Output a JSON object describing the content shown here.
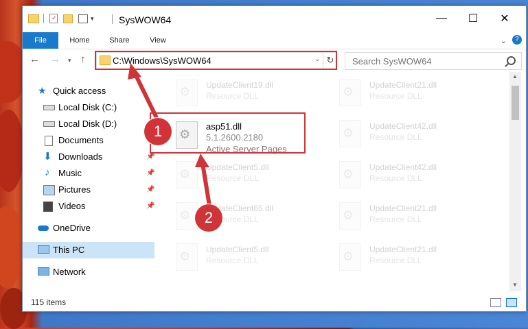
{
  "window": {
    "title": "SysWOW64",
    "minimize": "—",
    "maximize": "☐",
    "close": "✕"
  },
  "ribbon": {
    "tabs": [
      "File",
      "Home",
      "Share",
      "View"
    ]
  },
  "address": {
    "path": "C:\\Windows\\SysWOW64",
    "search_placeholder": "Search SysWOW64"
  },
  "sidebar": {
    "items": [
      {
        "label": "Quick access",
        "icon": "star-icon"
      },
      {
        "label": "Local Disk (C:)",
        "icon": "drive-icon"
      },
      {
        "label": "Local Disk (D:)",
        "icon": "drive-icon"
      },
      {
        "label": "Documents",
        "icon": "document-icon"
      },
      {
        "label": "Downloads",
        "icon": "download-icon"
      },
      {
        "label": "Music",
        "icon": "music-icon"
      },
      {
        "label": "Pictures",
        "icon": "picture-icon"
      },
      {
        "label": "Videos",
        "icon": "video-icon"
      },
      {
        "label": "OneDrive",
        "icon": "cloud-icon"
      },
      {
        "label": "This PC",
        "icon": "computer-icon"
      },
      {
        "label": "Network",
        "icon": "network-icon"
      }
    ]
  },
  "files": {
    "left": [
      {
        "name": "UpdateClient19.dll",
        "desc": "Resource DLL"
      },
      {
        "name": "UpdateClient5.dll",
        "desc": "Resource DLL"
      },
      {
        "name": "UpdateClient65.dll",
        "desc": "Resource DLL"
      },
      {
        "name": "UpdateClient5.dll",
        "desc": "Resource DLL"
      }
    ],
    "right": [
      {
        "name": "UpdateClient21.dll",
        "desc": "Resource DLL"
      },
      {
        "name": "UpdateClient42.dll",
        "desc": "Resource DLL"
      },
      {
        "name": "UpdateClient42.dll",
        "desc": "Resource DLL"
      },
      {
        "name": "UpdateClient21.dll",
        "desc": "Resource DLL"
      },
      {
        "name": "UpdateClient21.dll",
        "desc": "Resource DLL"
      }
    ],
    "selected": {
      "name": "asp51.dll",
      "version": "5.1.2600.2180",
      "desc": "Active Server Pages"
    }
  },
  "status": {
    "count": "115 items"
  },
  "markers": [
    "1",
    "2"
  ],
  "colors": {
    "accent": "#1979ca",
    "highlight": "#d13438"
  }
}
